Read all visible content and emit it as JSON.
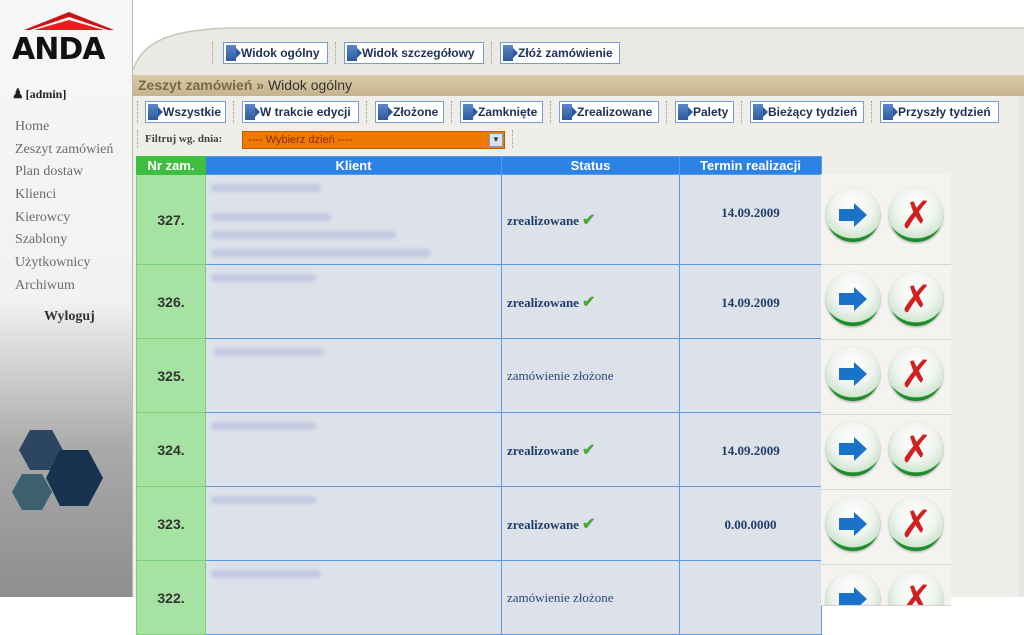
{
  "brand": {
    "logo_text": "ANDA",
    "colors": {
      "accent": "#2d82e6",
      "nr_header": "#3fbf3f",
      "filter": "#f07a00"
    }
  },
  "sidebar": {
    "user": "[admin]",
    "items": [
      {
        "label": "Home"
      },
      {
        "label": "Zeszyt zamówień"
      },
      {
        "label": "Plan dostaw"
      },
      {
        "label": "Klienci"
      },
      {
        "label": "Kierowcy"
      },
      {
        "label": "Szablony"
      },
      {
        "label": "Użytkownicy"
      },
      {
        "label": "Archiwum"
      }
    ],
    "logout": "Wyloguj"
  },
  "top_nav": {
    "buttons": [
      {
        "label": "Widok ogólny"
      },
      {
        "label": "Widok szczegółowy"
      },
      {
        "label": "Złóż zamówienie"
      }
    ]
  },
  "breadcrumb": {
    "section": "Zeszyt zamówień",
    "separator": "»",
    "current": "Widok ogólny"
  },
  "filter_tabs": [
    {
      "label": "Wszystkie"
    },
    {
      "label": "W trakcie edycji"
    },
    {
      "label": "Złożone"
    },
    {
      "label": "Zamknięte"
    },
    {
      "label": "Zrealizowane"
    },
    {
      "label": "Palety"
    },
    {
      "label": "Bieżący tydzień"
    },
    {
      "label": "Przyszły tydzień"
    }
  ],
  "filter": {
    "label": "Filtruj wg. dnia:",
    "selected": "---- Wybierz dzień ----",
    "dropdown_icon": "chevron-down-icon"
  },
  "table": {
    "headers": {
      "nr": "Nr zam.",
      "client": "Klient",
      "status": "Status",
      "date": "Termin realizacji"
    },
    "rows": [
      {
        "nr": "327.",
        "status": "zrealizowane",
        "status_check": true,
        "date": "14.09.2009"
      },
      {
        "nr": "326.",
        "status": "zrealizowane",
        "status_check": true,
        "date": "14.09.2009"
      },
      {
        "nr": "325.",
        "status": "zamówienie złożone",
        "status_check": false,
        "date": ""
      },
      {
        "nr": "324.",
        "status": "zrealizowane",
        "status_check": true,
        "date": "14.09.2009"
      },
      {
        "nr": "323.",
        "status": "zrealizowane",
        "status_check": true,
        "date": "0.00.0000"
      },
      {
        "nr": "322.",
        "status": "zamówienie złożone",
        "status_check": false,
        "date": ""
      }
    ]
  },
  "icons": {
    "open": "arrow-right-icon",
    "delete": "delete-x-icon",
    "check": "check-icon"
  }
}
